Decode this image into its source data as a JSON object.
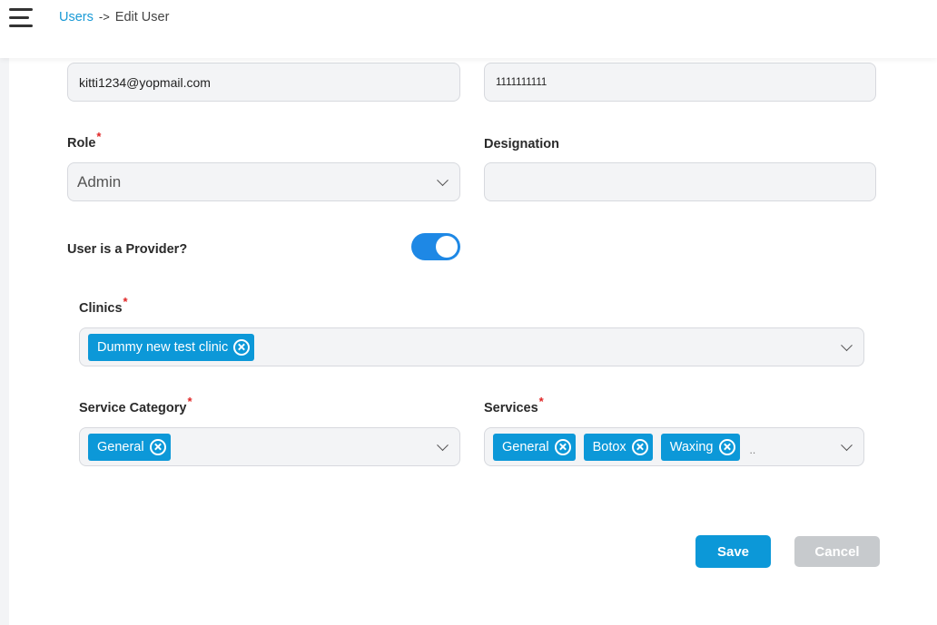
{
  "header": {
    "menu_icon": "hamburger-menu-icon",
    "breadcrumb": {
      "link": "Users",
      "separator": "->",
      "current": "Edit User"
    }
  },
  "form": {
    "email_value": "kitti1234@yopmail.com",
    "phone_value": "1111111111",
    "role": {
      "label": "Role",
      "value": "Admin"
    },
    "designation": {
      "label": "Designation",
      "value": ""
    },
    "provider": {
      "label": "User is a Provider?",
      "enabled": true
    },
    "clinics": {
      "label": "Clinics",
      "tags": [
        "Dummy new test clinic"
      ]
    },
    "service_category": {
      "label": "Service Category",
      "tags": [
        "General"
      ]
    },
    "services": {
      "label": "Services",
      "tags": [
        "General",
        "Botox",
        "Waxing"
      ],
      "more": ".."
    },
    "required_mark": "*"
  },
  "actions": {
    "save_label": "Save",
    "cancel_label": "Cancel"
  },
  "colors": {
    "accent": "#0c98d8",
    "toggle": "#1e88e5",
    "required": "#e02424",
    "cancel_bg": "#c7cacd"
  }
}
